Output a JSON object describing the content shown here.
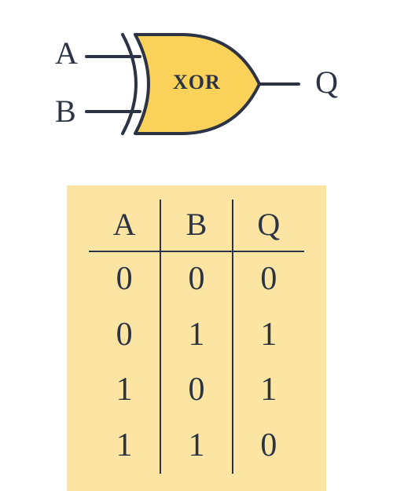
{
  "gate": {
    "type": "XOR",
    "label": "XOR",
    "inputs": {
      "a": "A",
      "b": "B"
    },
    "output": "Q"
  },
  "truth_table": {
    "headers": [
      "A",
      "B",
      "Q"
    ],
    "rows": [
      [
        "0",
        "0",
        "0"
      ],
      [
        "0",
        "1",
        "1"
      ],
      [
        "1",
        "0",
        "1"
      ],
      [
        "1",
        "1",
        "0"
      ]
    ]
  }
}
